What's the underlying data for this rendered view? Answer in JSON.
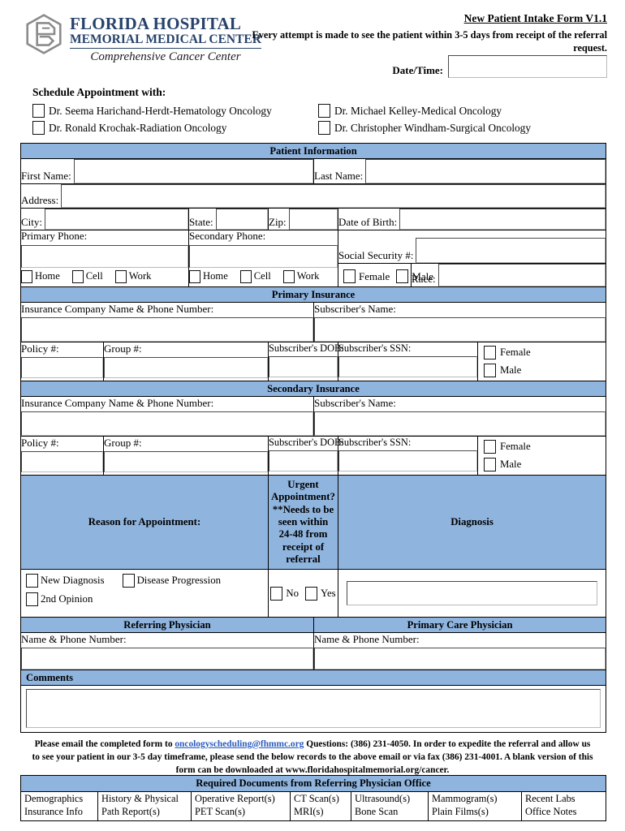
{
  "brand": {
    "line1": "FLORIDA HOSPITAL",
    "line2": "MEMORIAL MEDICAL CENTER",
    "line3": "Comprehensive Cancer Center",
    "color": "#27436b"
  },
  "header": {
    "title": "New Patient Intake Form V1.1",
    "subtitle": "Every attempt is made to see the patient within 3-5 days from receipt of the referral request.",
    "datetime_label": "Date/Time:",
    "datetime_value": ""
  },
  "schedule": {
    "title": "Schedule Appointment with:",
    "doctors": [
      {
        "label": "Dr. Seema Harichand-Herdt-Hematology Oncology",
        "checked": false
      },
      {
        "label": "Dr. Michael Kelley-Medical Oncology",
        "checked": false
      },
      {
        "label": "Dr. Ronald Krochak-Radiation Oncology",
        "checked": false
      },
      {
        "label": "Dr. Christopher Windham-Surgical Oncology",
        "checked": false
      }
    ]
  },
  "patient": {
    "band": "Patient Information",
    "first_name_label": "First Name:",
    "first_name_value": "",
    "last_name_label": "Last Name:",
    "last_name_value": "",
    "address_label": "Address:",
    "address_value": "",
    "city_label": "City:",
    "city_value": "",
    "state_label": "State:",
    "state_value": "",
    "zip_label": "Zip:",
    "zip_value": "",
    "dob_label": "Date of Birth:",
    "dob_value": "",
    "primary_phone_label": "Primary Phone:",
    "primary_phone_value": "",
    "secondary_phone_label": "Secondary Phone:",
    "secondary_phone_value": "",
    "phone_types": [
      "Home",
      "Cell",
      "Work"
    ],
    "ssn_label": "Social Security #:",
    "ssn_value": "",
    "female_label": "Female",
    "male_label": "Male",
    "race_label": "Race:",
    "race_value": ""
  },
  "primary_insurance": {
    "band": "Primary Insurance",
    "company_label": "Insurance Company Name & Phone Number:",
    "company_value": "",
    "subscriber_name_label": "Subscriber's Name:",
    "subscriber_name_value": "",
    "policy_label": "Policy #:",
    "policy_value": "",
    "group_label": "Group #:",
    "group_value": "",
    "dob_label": "Subscriber's DOB:",
    "dob_value": "",
    "ssn_label": "Subscriber's SSN:",
    "ssn_value": "",
    "female_label": "Female",
    "male_label": "Male"
  },
  "secondary_insurance": {
    "band": "Secondary Insurance",
    "company_label": "Insurance Company Name & Phone Number:",
    "company_value": "",
    "subscriber_name_label": "Subscriber's Name:",
    "subscriber_name_value": "",
    "policy_label": "Policy #:",
    "policy_value": "",
    "group_label": "Group #:",
    "group_value": "",
    "dob_label": "Subscriber's DOB:",
    "dob_value": "",
    "ssn_label": "Subscriber's SSN:",
    "ssn_value": "",
    "female_label": "Female",
    "male_label": "Male"
  },
  "appointment": {
    "reason_header": "Reason for Appointment:",
    "urgent_header": "Urgent Appointment? **Needs to be seen within 24-48 from receipt of referral",
    "diagnosis_header": "Diagnosis",
    "reason_options": [
      "New Diagnosis",
      "Disease Progression",
      "2nd Opinion"
    ],
    "urgent_no": "No",
    "urgent_yes": "Yes",
    "diagnosis_value": ""
  },
  "physicians": {
    "referring_header": "Referring Physician",
    "pcp_header": "Primary Care Physician",
    "referring_label": "Name & Phone Number:",
    "referring_value": "",
    "pcp_label": "Name & Phone Number:",
    "pcp_value": ""
  },
  "comments": {
    "band": "Comments",
    "value": ""
  },
  "footer": {
    "part1": "Please email the completed form to ",
    "email": "oncologyscheduling@fhmmc.org",
    "part2": " Questions: (386) 231-4050. In order to expedite the referral and allow us to see your patient in our 3-5 day timeframe, please send the below records to the above email or via fax (386) 231-4001.  A blank version of this form can be downloaded at www.floridahospitalmemorial.org/cancer."
  },
  "required_documents": {
    "header": "Required Documents from Referring Physician Office",
    "columns": [
      {
        "line1": "Demographics",
        "line2": "Insurance Info"
      },
      {
        "line1": "History & Physical",
        "line2": "Path Report(s)"
      },
      {
        "line1": "Operative Report(s)",
        "line2": "PET Scan(s)"
      },
      {
        "line1": "CT Scan(s)",
        "line2": "MRI(s)"
      },
      {
        "line1": "Ultrasound(s)",
        "line2": "Bone Scan"
      },
      {
        "line1": "Mammogram(s)",
        "line2": "Plain Films(s)"
      },
      {
        "line1": "Recent Labs",
        "line2": "Office Notes"
      }
    ]
  }
}
